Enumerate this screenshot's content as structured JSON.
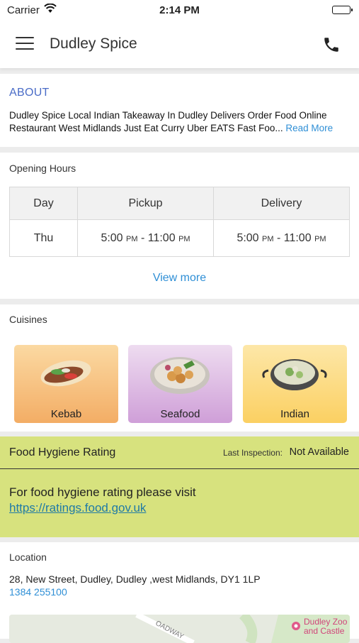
{
  "status_bar": {
    "carrier": "Carrier",
    "time": "2:14 PM"
  },
  "nav": {
    "title": "Dudley Spice"
  },
  "about": {
    "heading": "ABOUT",
    "text": "Dudley Spice Local Indian Takeaway In Dudley Delivers Order Food Online Restaurant West Midlands Just Eat Curry Uber EATS Fast Foo...",
    "read_more": "Read More"
  },
  "opening_hours": {
    "label": "Opening Hours",
    "headers": [
      "Day",
      "Pickup",
      "Delivery"
    ],
    "row": {
      "day": "Thu",
      "pickup_start": "5:00",
      "pickup_end": "11:00",
      "delivery_start": "5:00",
      "delivery_end": "11:00",
      "meridiem": "PM"
    },
    "view_more": "View more"
  },
  "cuisines": {
    "label": "Cuisines",
    "items": [
      {
        "name": "Kebab",
        "icon": "kebab-wrap-icon"
      },
      {
        "name": "Seafood",
        "icon": "seafood-bowl-icon"
      },
      {
        "name": "Indian",
        "icon": "indian-karahi-icon"
      }
    ]
  },
  "hygiene": {
    "title": "Food Hygiene Rating",
    "last_inspection_label": "Last Inspection:",
    "last_inspection_value": "Not Available",
    "message": "For food hygiene rating please visit",
    "link": "https://ratings.food.gov.uk"
  },
  "location": {
    "label": "Location",
    "address": "28, New Street, Dudley, Dudley ,west Midlands, DY1 1LP",
    "phone": "1384 255100",
    "map_labels": [
      "Dudley Zoo",
      "and Castle"
    ],
    "road_label": "OADWAY"
  },
  "colors": {
    "accent": "#2f8fd6",
    "about_heading": "#4a6cc7",
    "hygiene_bg": "#d7e27e"
  }
}
